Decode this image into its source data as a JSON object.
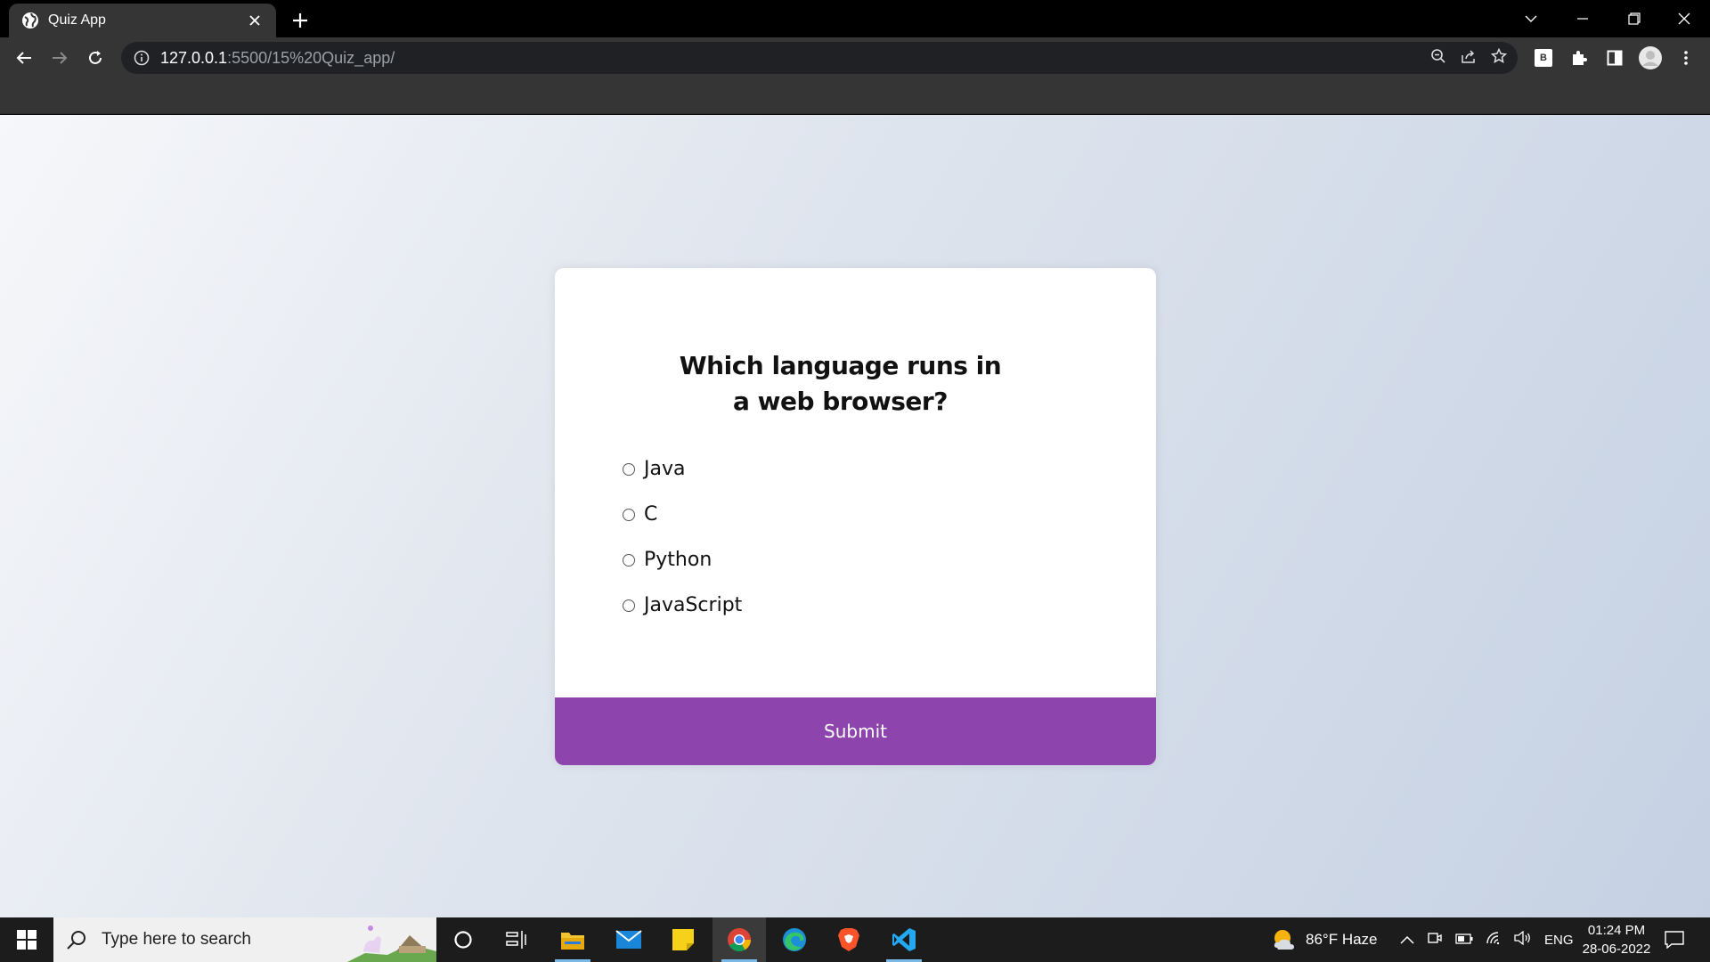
{
  "browser": {
    "tab_title": "Quiz App",
    "url_host": "127.0.0.1",
    "url_path": ":5500/15%20Quiz_app/",
    "extension_badge": "B"
  },
  "quiz": {
    "question": "Which language runs in a web browser?",
    "answers": [
      "Java",
      "C",
      "Python",
      "JavaScript"
    ],
    "submit_label": "Submit",
    "accent_color": "#8e44ad"
  },
  "taskbar": {
    "search_placeholder": "Type here to search",
    "weather": "86°F  Haze",
    "language": "ENG",
    "time": "01:24 PM",
    "date": "28-06-2022"
  }
}
